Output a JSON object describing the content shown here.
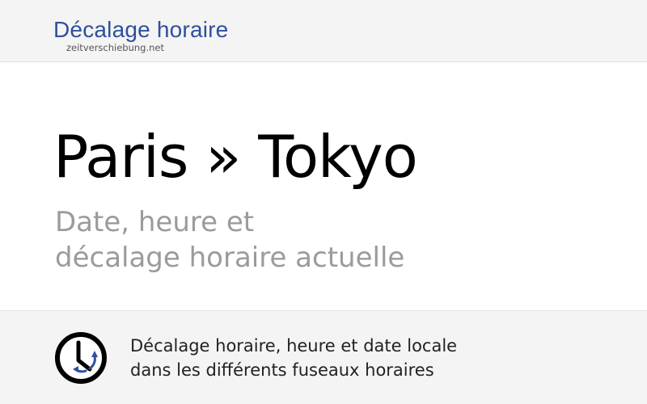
{
  "header": {
    "brand_title": "Décalage horaire",
    "brand_domain": "zeitverschiebung.net"
  },
  "hero": {
    "title": "Paris » Tokyo",
    "subtitle_line1": "Date, heure et",
    "subtitle_line2": "décalage horaire actuelle"
  },
  "footer": {
    "icon": "clock-icon",
    "text_line1": "Décalage horaire, heure et date locale",
    "text_line2": "dans les différents fuseaux horaires"
  },
  "colors": {
    "brand": "#2f4f9e",
    "icon_arrows": "#2f4f9e",
    "subtitle": "#9b9b9b",
    "band_background": "#f4f4f4"
  }
}
